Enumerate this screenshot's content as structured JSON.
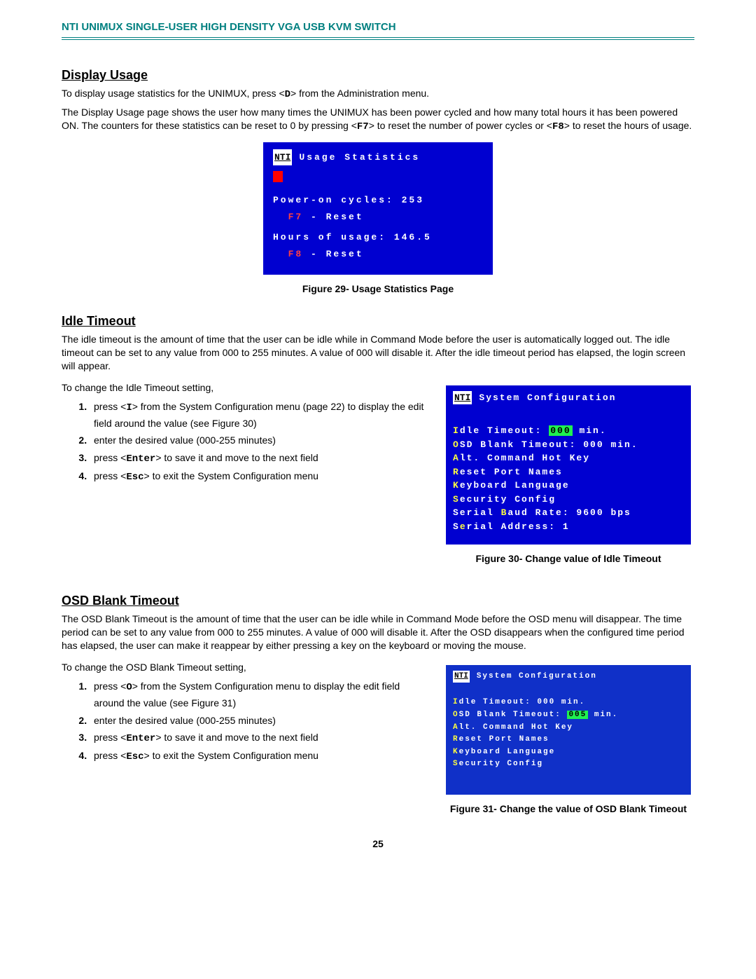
{
  "header": {
    "title": "NTI UNIMUX SINGLE-USER HIGH DENSITY VGA USB KVM SWITCH"
  },
  "section1": {
    "heading": "Display Usage",
    "p1a": "To display usage statistics for the UNIMUX,  press <",
    "p1key": "D",
    "p1b": "> from the Administration menu.",
    "p2a": "The Display Usage page shows the user how many times the UNIMUX has been power cycled and how many total hours it has been powered ON.    The counters for these statistics can be reset to 0 by pressing <",
    "p2key1": "F7",
    "p2b": "> to reset the number of power cycles or <",
    "p2key2": "F8",
    "p2c": "> to reset the hours of usage."
  },
  "fig29": {
    "nti": "NTI",
    "title": "Usage Statistics",
    "line1": "Power-on cycles: 253",
    "line2a": "F7",
    "line2b": " - Reset",
    "line3": "Hours of usage: 146.5",
    "line4a": "F8",
    "line4b": " - Reset",
    "caption": "Figure 29- Usage Statistics Page"
  },
  "section2": {
    "heading": "Idle Timeout",
    "p1": "The idle timeout is the amount of time that the user can be idle while in Command Mode before the user is automatically logged out.    The idle timeout can be set to any value from 000 to 255 minutes.   A value of 000 will disable it.   After the idle timeout period has elapsed, the login screen will appear.",
    "lead": "To change the Idle Timeout setting,",
    "steps": {
      "s1a": "press <",
      "s1key": "I",
      "s1b": "> from the System Configuration menu (page 22) to display the edit field around the value (see Figure 30)",
      "s2": "enter the desired value (000-255 minutes)",
      "s3a": "press <",
      "s3key": "Enter",
      "s3b": "> to save it and move to the next field",
      "s4a": "press <",
      "s4key": "Esc",
      "s4b": "> to exit the System Configuration menu"
    }
  },
  "fig30": {
    "nti": "NTI",
    "title": "System Configuration",
    "l1a": "I",
    "l1b": "dle Timeout: ",
    "l1val": "000",
    "l1c": " min.",
    "l2a": "O",
    "l2b": "SD Blank Timeout: 000 min.",
    "l3a": "A",
    "l3b": "lt. Command Hot Key",
    "l4a": "R",
    "l4b": "eset Port Names",
    "l5a": "K",
    "l5b": "eyboard Language",
    "l6a": "S",
    "l6b": "ecurity Config",
    "l7a": "Serial ",
    "l7b": "B",
    "l7c": "aud Rate: 9600  bps",
    "l8a": "S",
    "l8b": "e",
    "l8c": "rial Address: 1",
    "caption": "Figure 30- Change value of Idle Timeout"
  },
  "section3": {
    "heading": "OSD Blank Timeout",
    "p1": "The OSD Blank Timeout is the amount of time that the user can be idle while in Command Mode before the OSD menu will disappear.   The time period can be set to any value from 000 to 255 minutes.   A value of 000 will disable it.   After the OSD disappears when the configured time period has elapsed, the user can make it reappear by either pressing a key on the keyboard or moving the mouse.",
    "lead": "To change the OSD Blank Timeout setting,",
    "steps": {
      "s1a": "press <",
      "s1key": "O",
      "s1b": "> from the System Configuration menu to display the  edit field around the value (see Figure 31)",
      "s2": "enter the desired value (000-255 minutes)",
      "s3a": "press <",
      "s3key": "Enter",
      "s3b": "> to save it and move to the next field",
      "s4a": "press <",
      "s4key": "Esc",
      "s4b": "> to exit the System Configuration menu"
    }
  },
  "fig31": {
    "nti": "NTI",
    "title": "System Configuration",
    "l1a": "I",
    "l1b": "dle Timeout: 000 min.",
    "l2a": "O",
    "l2b": "SD Blank Timeout: ",
    "l2val": "005",
    "l2c": " min.",
    "l3a": "A",
    "l3b": "lt. Command Hot Key",
    "l4a": "R",
    "l4b": "eset Port Names",
    "l5a": "K",
    "l5b": "eyboard Language",
    "l6a": "S",
    "l6b": "ecurity Config",
    "caption": "Figure 31- Change the value of OSD Blank Timeout"
  },
  "footer": {
    "page_number": "25"
  }
}
